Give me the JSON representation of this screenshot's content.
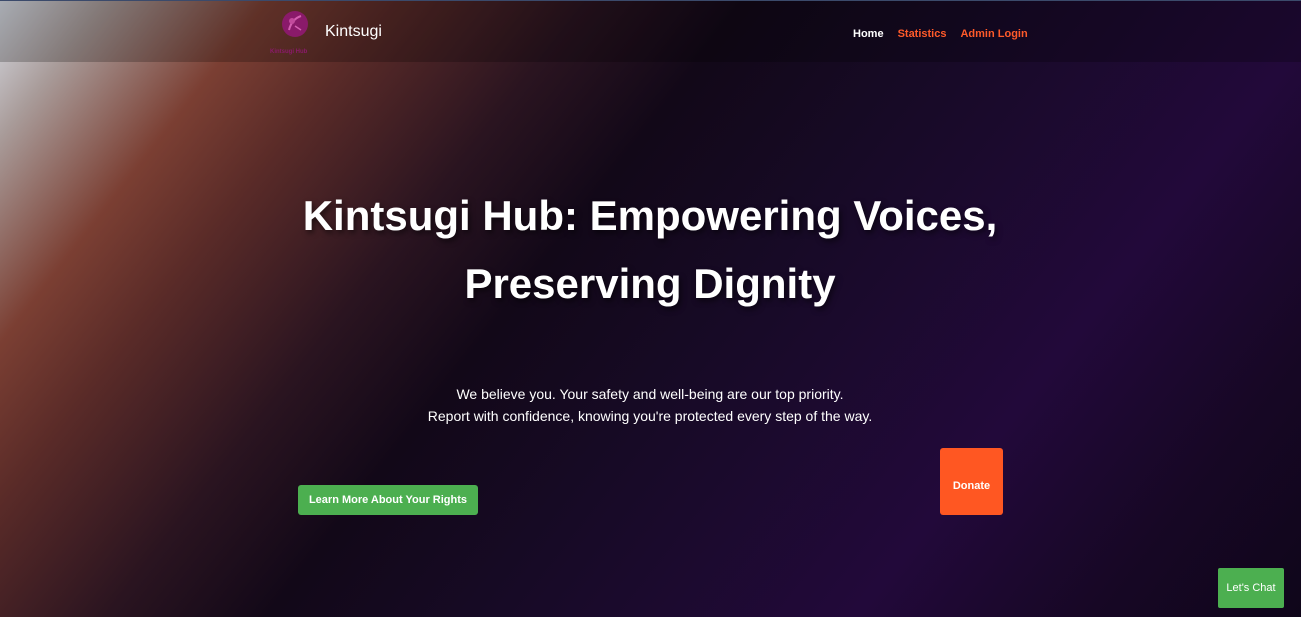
{
  "header": {
    "brand": "Kintsugi",
    "logo_caption": "Kintsugi Hub",
    "nav": [
      {
        "label": "Home"
      },
      {
        "label": "Statistics"
      },
      {
        "label": "Admin Login"
      }
    ]
  },
  "hero": {
    "title_line1": "Kintsugi Hub: Empowering Voices,",
    "title_line2": "Preserving Dignity",
    "subtitle_line1": "We believe you. Your safety and well-being are our top priority.",
    "subtitle_line2": "Report with confidence, knowing you're protected every step of the way.",
    "rights_button": "Learn More About Your Rights",
    "donate_button": "Donate"
  },
  "chat": {
    "label": "Let's Chat"
  },
  "colors": {
    "accent_orange": "#ff5722",
    "accent_green": "#4caf50",
    "logo_purple": "#8a1a6a"
  }
}
